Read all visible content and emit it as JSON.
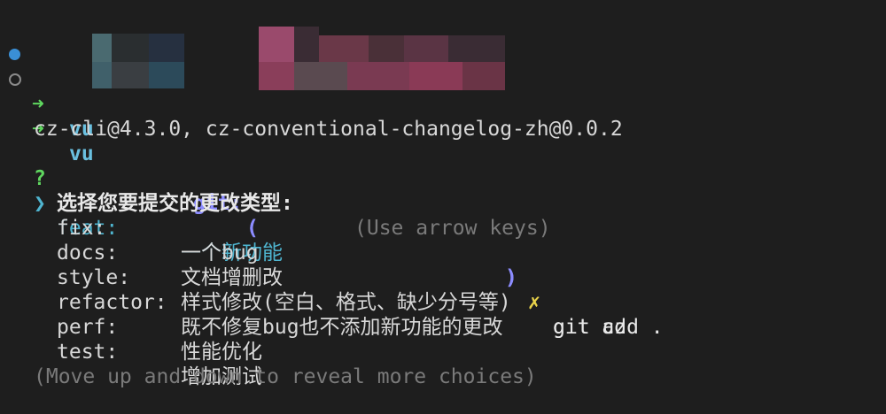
{
  "prompt_lines": [
    {
      "dir": "vu",
      "git_label": "git:",
      "branch_open": "(",
      "branch_close": ")",
      "cross": "✗",
      "command": "git add ."
    },
    {
      "dir": "vu",
      "git_label": "git:",
      "branch_open": "(",
      "branch_close": ")",
      "cross": "✗",
      "command": "git cz"
    }
  ],
  "arrow_glyph": "➜",
  "version_line": "cz-cli@4.3.0, cz-conventional-changelog-zh@0.0.2",
  "question": {
    "mark": "?",
    "text": "选择您要提交的更改类型:",
    "hint": "(Use arrow keys)"
  },
  "pointer_glyph": "❯",
  "choices": [
    {
      "key": "feat:",
      "desc": "一个新功能",
      "selected": true
    },
    {
      "key": "fix:",
      "desc": "一个bug",
      "selected": false
    },
    {
      "key": "docs:",
      "desc": "文档增删改",
      "selected": false
    },
    {
      "key": "style:",
      "desc": "样式修改(空白、格式、缺少分号等)",
      "selected": false
    },
    {
      "key": "refactor:",
      "desc": "既不修复bug也不添加新功能的更改",
      "selected": false
    },
    {
      "key": "perf:",
      "desc": "性能优化",
      "selected": false
    },
    {
      "key": "test:",
      "desc": "增加测试",
      "selected": false
    }
  ],
  "footer": "(Move up and down to reveal more choices)",
  "colors": {
    "background": "#1e1e1e",
    "arrow": "#5fd75f",
    "git": "#8c8cff",
    "cross": "#e8d24a",
    "selected": "#4fb5d0"
  }
}
